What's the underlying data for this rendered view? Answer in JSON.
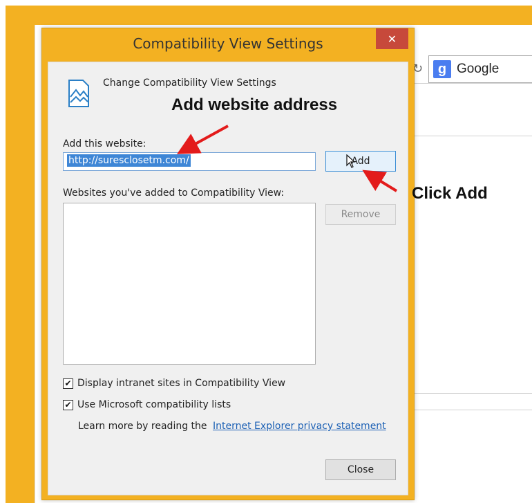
{
  "background": {
    "search_engine": "Google",
    "search_icon": "google-icon",
    "refresh_icon": "refresh-icon"
  },
  "dialog": {
    "title": "Compatibility View Settings",
    "close_glyph": "✕",
    "header_text": "Change Compatibility View Settings",
    "add_label": "Add this website:",
    "url_value": "http://suresclosetm.com/",
    "add_button": "Add",
    "list_label": "Websites you've added to Compatibility View:",
    "remove_button": "Remove",
    "sites": [],
    "options": [
      {
        "label": "Display intranet sites in Compatibility View",
        "checked": true
      },
      {
        "label": "Use Microsoft compatibility lists",
        "checked": true
      }
    ],
    "learn_prefix": "Learn more by reading the",
    "learn_link": "Internet Explorer privacy statement",
    "close_button": "Close"
  },
  "annotations": {
    "add_website": "Add website address",
    "click_add": "Click Add",
    "arrow_color": "#e31b1b"
  },
  "colors": {
    "window_frame": "#f3b122",
    "close_red": "#c7493b",
    "selection_blue": "#3e86d6",
    "link_blue": "#1a5fb4"
  }
}
